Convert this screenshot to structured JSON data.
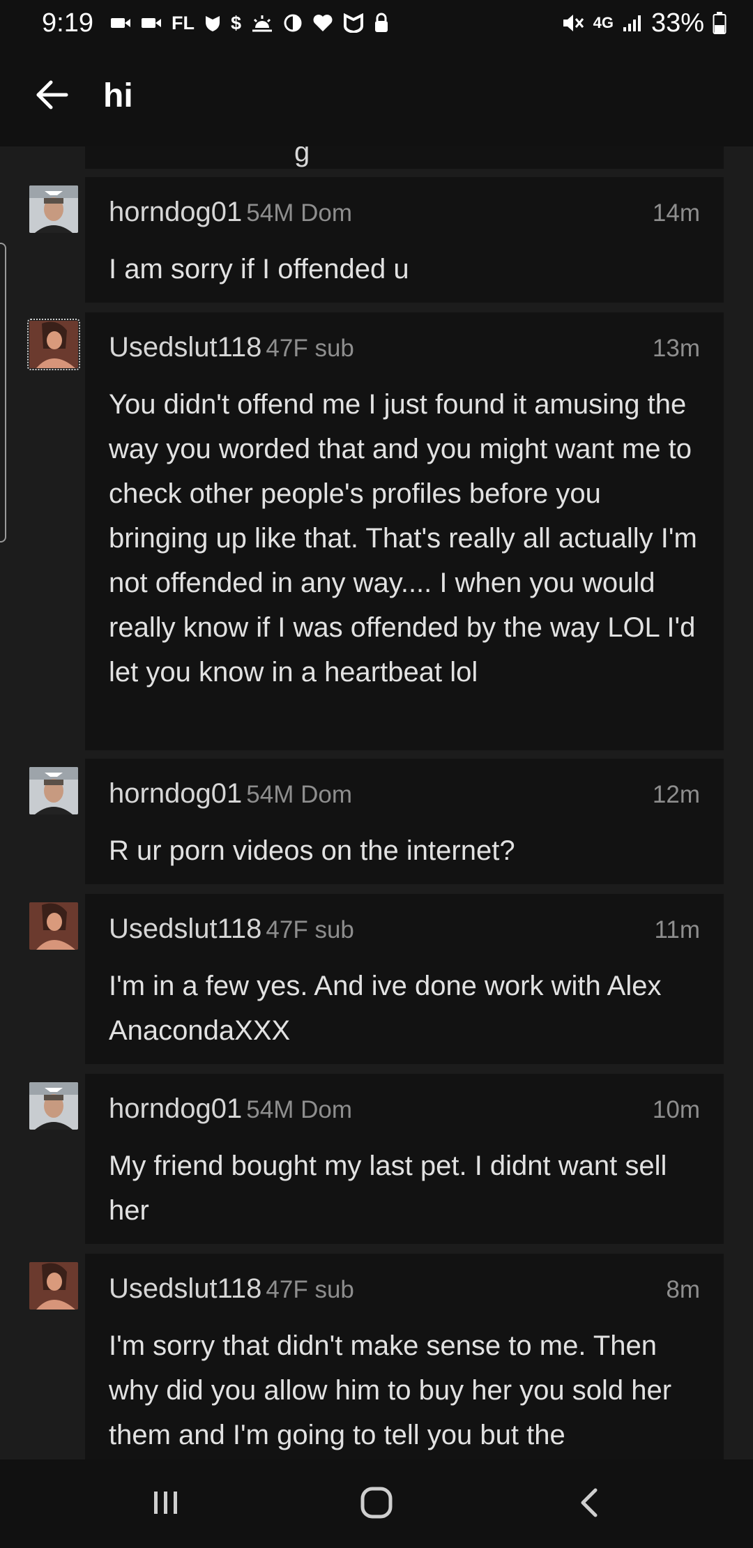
{
  "status_bar": {
    "time": "9:19",
    "carrier_text": "FL",
    "dollar_text": "$",
    "network": "4G",
    "battery": "33%",
    "icons": [
      "video-icon",
      "video-icon",
      "shield-icon",
      "dollar-icon",
      "weather-icon",
      "contrast-icon",
      "heart-icon",
      "badge-icon",
      "lock-icon",
      "mute-icon",
      "signal-icon",
      "battery-icon"
    ]
  },
  "app_bar": {
    "title": "hi",
    "back_icon": "arrow-left-icon"
  },
  "messages": [
    {
      "username": "horndog01",
      "info": "54M Dom",
      "time": "14m",
      "text": "I am sorry if I offended u",
      "avatar": "male"
    },
    {
      "username": "Usedslut118",
      "info": "47F sub",
      "time": "13m",
      "text": "You didn't offend me I just found it amusing the way you worded that and you might want me to check other people's profiles before you bringing up like that. That's really all actually I'm not offended in any way.... I when you would really know if I was offended by the way LOL I'd let you know in a heartbeat lol",
      "avatar": "female"
    },
    {
      "username": "horndog01",
      "info": "54M Dom",
      "time": "12m",
      "text": "R ur porn videos on the internet?",
      "avatar": "male"
    },
    {
      "username": "Usedslut118",
      "info": "47F sub",
      "time": "11m",
      "text": "I'm in a few yes. And ive done work with Alex AnacondaXXX",
      "avatar": "female"
    },
    {
      "username": "horndog01",
      "info": "54M Dom",
      "time": "10m",
      "text": "My friend bought my last pet. I didnt want sell her",
      "avatar": "male"
    },
    {
      "username": "Usedslut118",
      "info": "47F sub",
      "time": "8m",
      "text": "I'm sorry that didn't make sense to me. Then why did you allow him to buy her you sold her them and I'm going to tell you but the",
      "avatar": "female"
    }
  ],
  "nav_bar": {
    "buttons": [
      "recent-apps-icon",
      "home-icon",
      "back-icon"
    ]
  },
  "colors": {
    "background": "#1c1c1c",
    "card": "#121212",
    "bars": "#111111",
    "text": "#e2e2e2",
    "muted": "#8e8e8e"
  }
}
